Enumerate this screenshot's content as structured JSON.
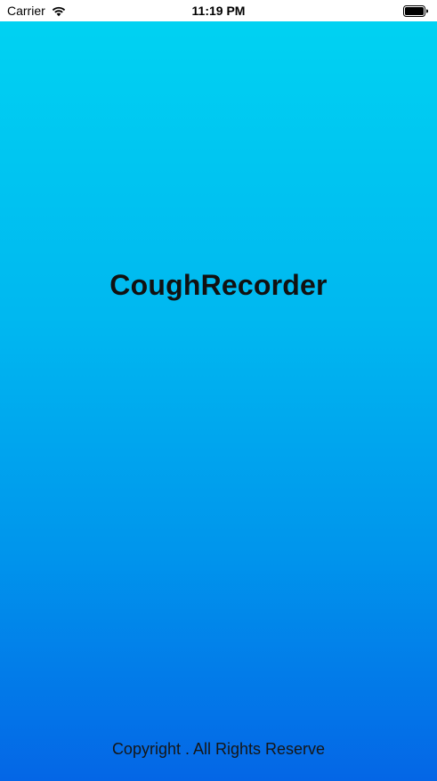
{
  "status_bar": {
    "carrier": "Carrier",
    "time": "11:19 PM",
    "icons": [
      "wifi-icon",
      "battery-icon"
    ]
  },
  "app": {
    "title": "CoughRecorder",
    "footer": "Copyright . All Rights Reserve"
  },
  "colors": {
    "gradient_top": "#00d2f2",
    "gradient_bottom": "#0466e6",
    "title_text": "#111111"
  }
}
